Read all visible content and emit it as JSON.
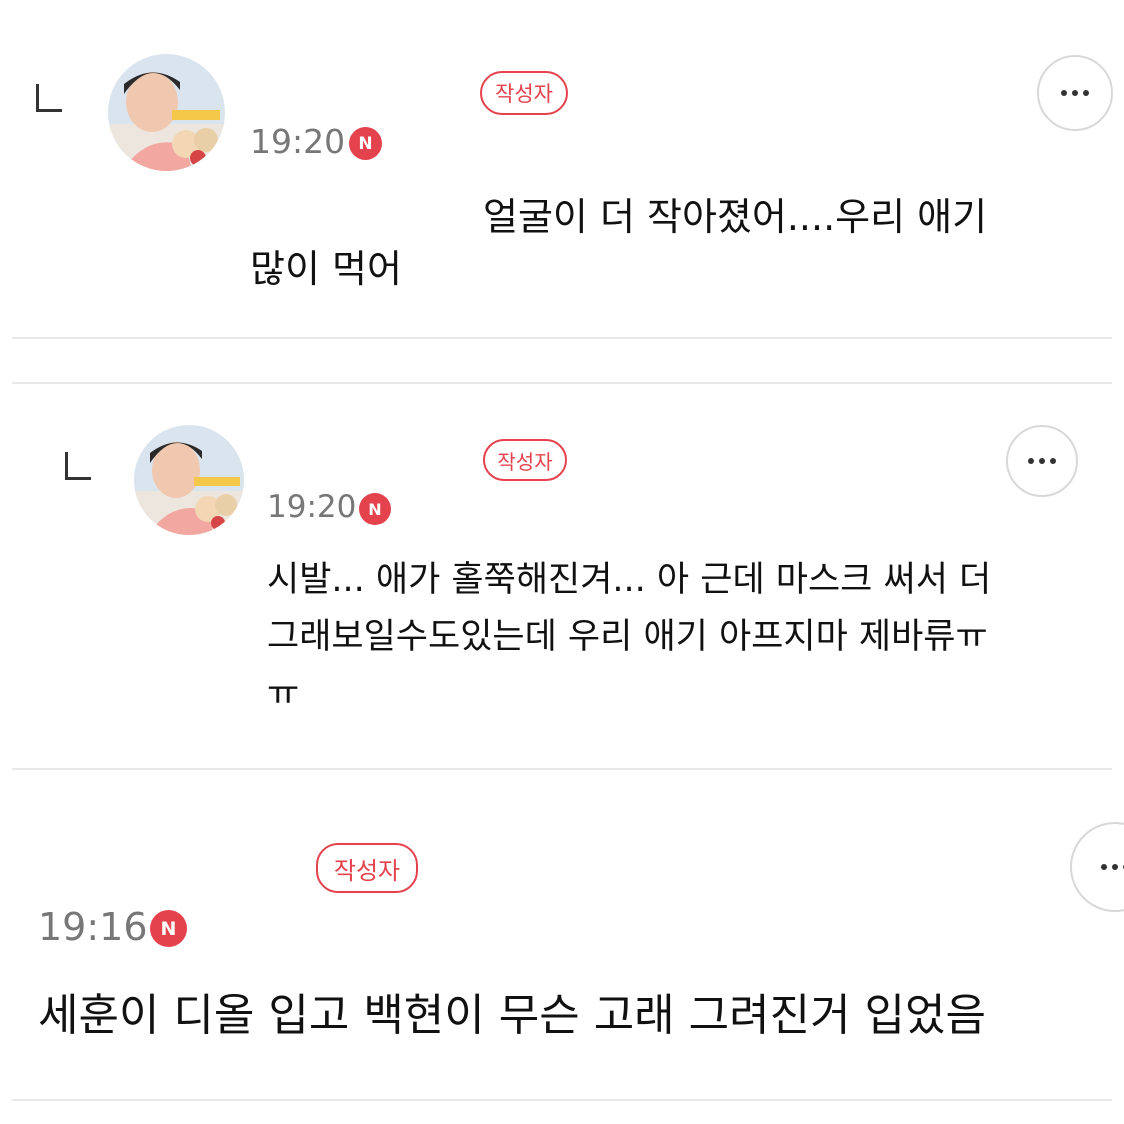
{
  "comments": [
    {
      "author_badge": "작성자",
      "time": "19:20",
      "new_badge": "N",
      "line1": "얼굴이 더 작아졌어....우리 애기",
      "line2": "많이 먹어",
      "is_reply": true
    },
    {
      "author_badge": "작성자",
      "time": "19:20",
      "new_badge": "N",
      "line1": "시발... 애가 홀쭉해진겨... 아 근데 마스크 써서 더",
      "line2": "그래보일수도있는데 우리 애기 아프지마 제바류ㅠ",
      "line3": "ㅠ",
      "is_reply": true
    },
    {
      "author_badge": "작성자",
      "time": "19:16",
      "new_badge": "N",
      "line1": "세훈이 디올 입고 백현이 무슨 고래 그려진거 입었음",
      "is_reply": false
    }
  ],
  "colors": {
    "accent": "#e4424c",
    "time": "#777777",
    "divider": "#e8e8e8"
  },
  "icons": {
    "more": "more-dots-icon",
    "reply": "reply-arrow-icon",
    "new": "new-badge-icon"
  }
}
